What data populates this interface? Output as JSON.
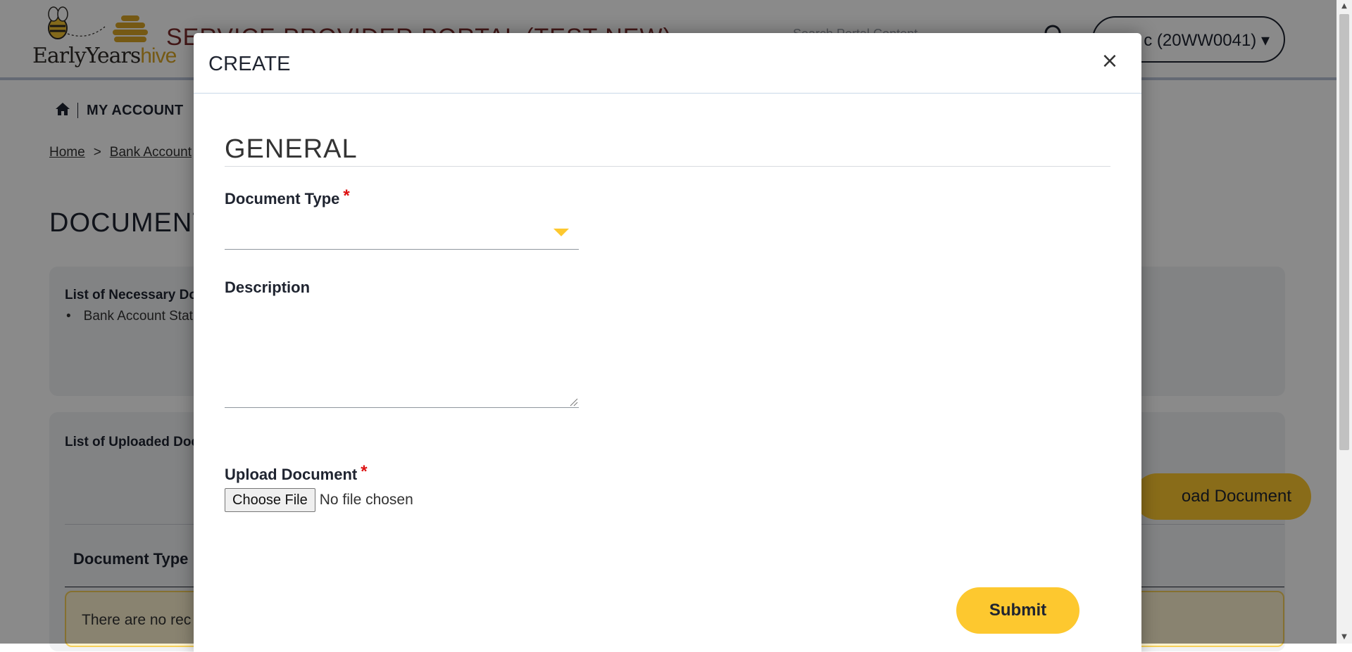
{
  "header": {
    "logo_text_early": "Early",
    "logo_text_years": "Years",
    "logo_text_hive": "hive",
    "portal_title": "SERVICE PROVIDER PORTAL (TEST NEW)",
    "search_placeholder": "Search Portal Content",
    "user_menu_label": "c (20WW0041) ▾"
  },
  "nav": {
    "my_account": "MY ACCOUNT"
  },
  "breadcrumb": {
    "home": "Home",
    "separator": ">",
    "current": "Bank Account"
  },
  "page": {
    "title": "DOCUMENT",
    "card1_title": "List of Necessary Doc",
    "card1_bullet": "Bank Account Stat",
    "card2_title": "List of Uploaded Docu",
    "upload_button": "oad Document",
    "table_header": "Document Type",
    "no_records": "There are no rec"
  },
  "modal": {
    "title": "CREATE",
    "close_symbol": "×",
    "section_title": "GENERAL",
    "document_type_label": "Document Type",
    "required_mark": "*",
    "description_label": "Description",
    "upload_document_label": "Upload Document",
    "choose_file_label": "Choose File",
    "no_file_text": "No file chosen",
    "submit_label": "Submit"
  },
  "colors": {
    "accent_yellow": "#fdc82f",
    "required_red": "#dd1111",
    "brand_maroon": "#7a2b2b"
  }
}
